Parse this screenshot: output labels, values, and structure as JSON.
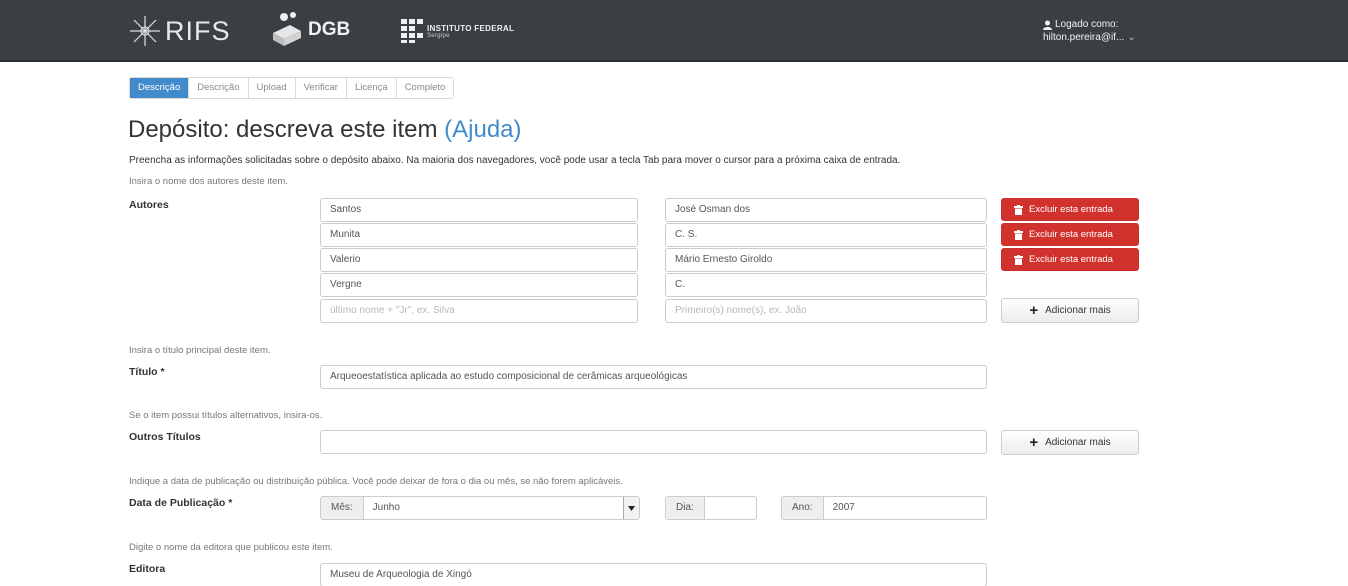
{
  "header": {
    "logo_rifs": "RIFS",
    "logo_dgb": "DGB",
    "logo_if": "INSTITUTO FEDERAL",
    "logo_if_sub": "Sergipe",
    "logged_as_label": "Logado como:",
    "user": "hilton.pereira@if...",
    "colors": {
      "navbar": "#3a3f44",
      "primary": "#428bca",
      "danger": "#d2322d"
    }
  },
  "tabs": [
    {
      "label": "Descrição",
      "active": true
    },
    {
      "label": "Descrição",
      "active": false
    },
    {
      "label": "Upload",
      "active": false
    },
    {
      "label": "Verificar",
      "active": false
    },
    {
      "label": "Licença",
      "active": false
    },
    {
      "label": "Completo",
      "active": false
    }
  ],
  "page": {
    "title": "Depósito: descreva este item",
    "help_link": "(Ajuda)",
    "intro": "Preencha as informações solicitadas sobre o depósito abaixo. Na maioria dos navegadores, você pode usar a tecla Tab para mover o cursor para a próxima caixa de entrada."
  },
  "authors": {
    "hint": "Insira o nome dos autores deste item.",
    "label": "Autores",
    "rows": [
      {
        "last": "Santos",
        "first": "José Osman dos"
      },
      {
        "last": "Munita",
        "first": "C. S."
      },
      {
        "last": "Valerio",
        "first": "Mário Ernesto Giroldo"
      },
      {
        "last": "Vergne",
        "first": "C."
      }
    ],
    "placeholder_last": "último nome + \"Jr\", ex. Silva",
    "placeholder_first": "Primeiro(s) nome(s), ex. João",
    "delete_label": "Excluir esta entrada",
    "add_more_label": "Adicionar mais"
  },
  "title_field": {
    "hint": "Insira o título principal deste item.",
    "label": "Título *",
    "value": "Arqueoestatística aplicada ao estudo composicional de cerâmicas arqueológicas"
  },
  "alt_titles": {
    "hint": "Se o item possui títulos alternativos, insira-os.",
    "label": "Outros Títulos",
    "value": "",
    "add_more_label": "Adicionar mais"
  },
  "pub_date": {
    "hint": "Indique a data de publicação ou distribuição pública. Você pode deixar de fora o dia ou mês, se não forem aplicáveis.",
    "label": "Data de Publicação *",
    "month_label": "Mês:",
    "month_value": "Junho",
    "day_label": "Dia:",
    "day_value": "",
    "year_label": "Ano:",
    "year_value": "2007"
  },
  "publisher": {
    "hint": "Digite o nome da editora que publicou este item.",
    "label": "Editora",
    "value": "Museu de Arqueologia de Xingó"
  }
}
